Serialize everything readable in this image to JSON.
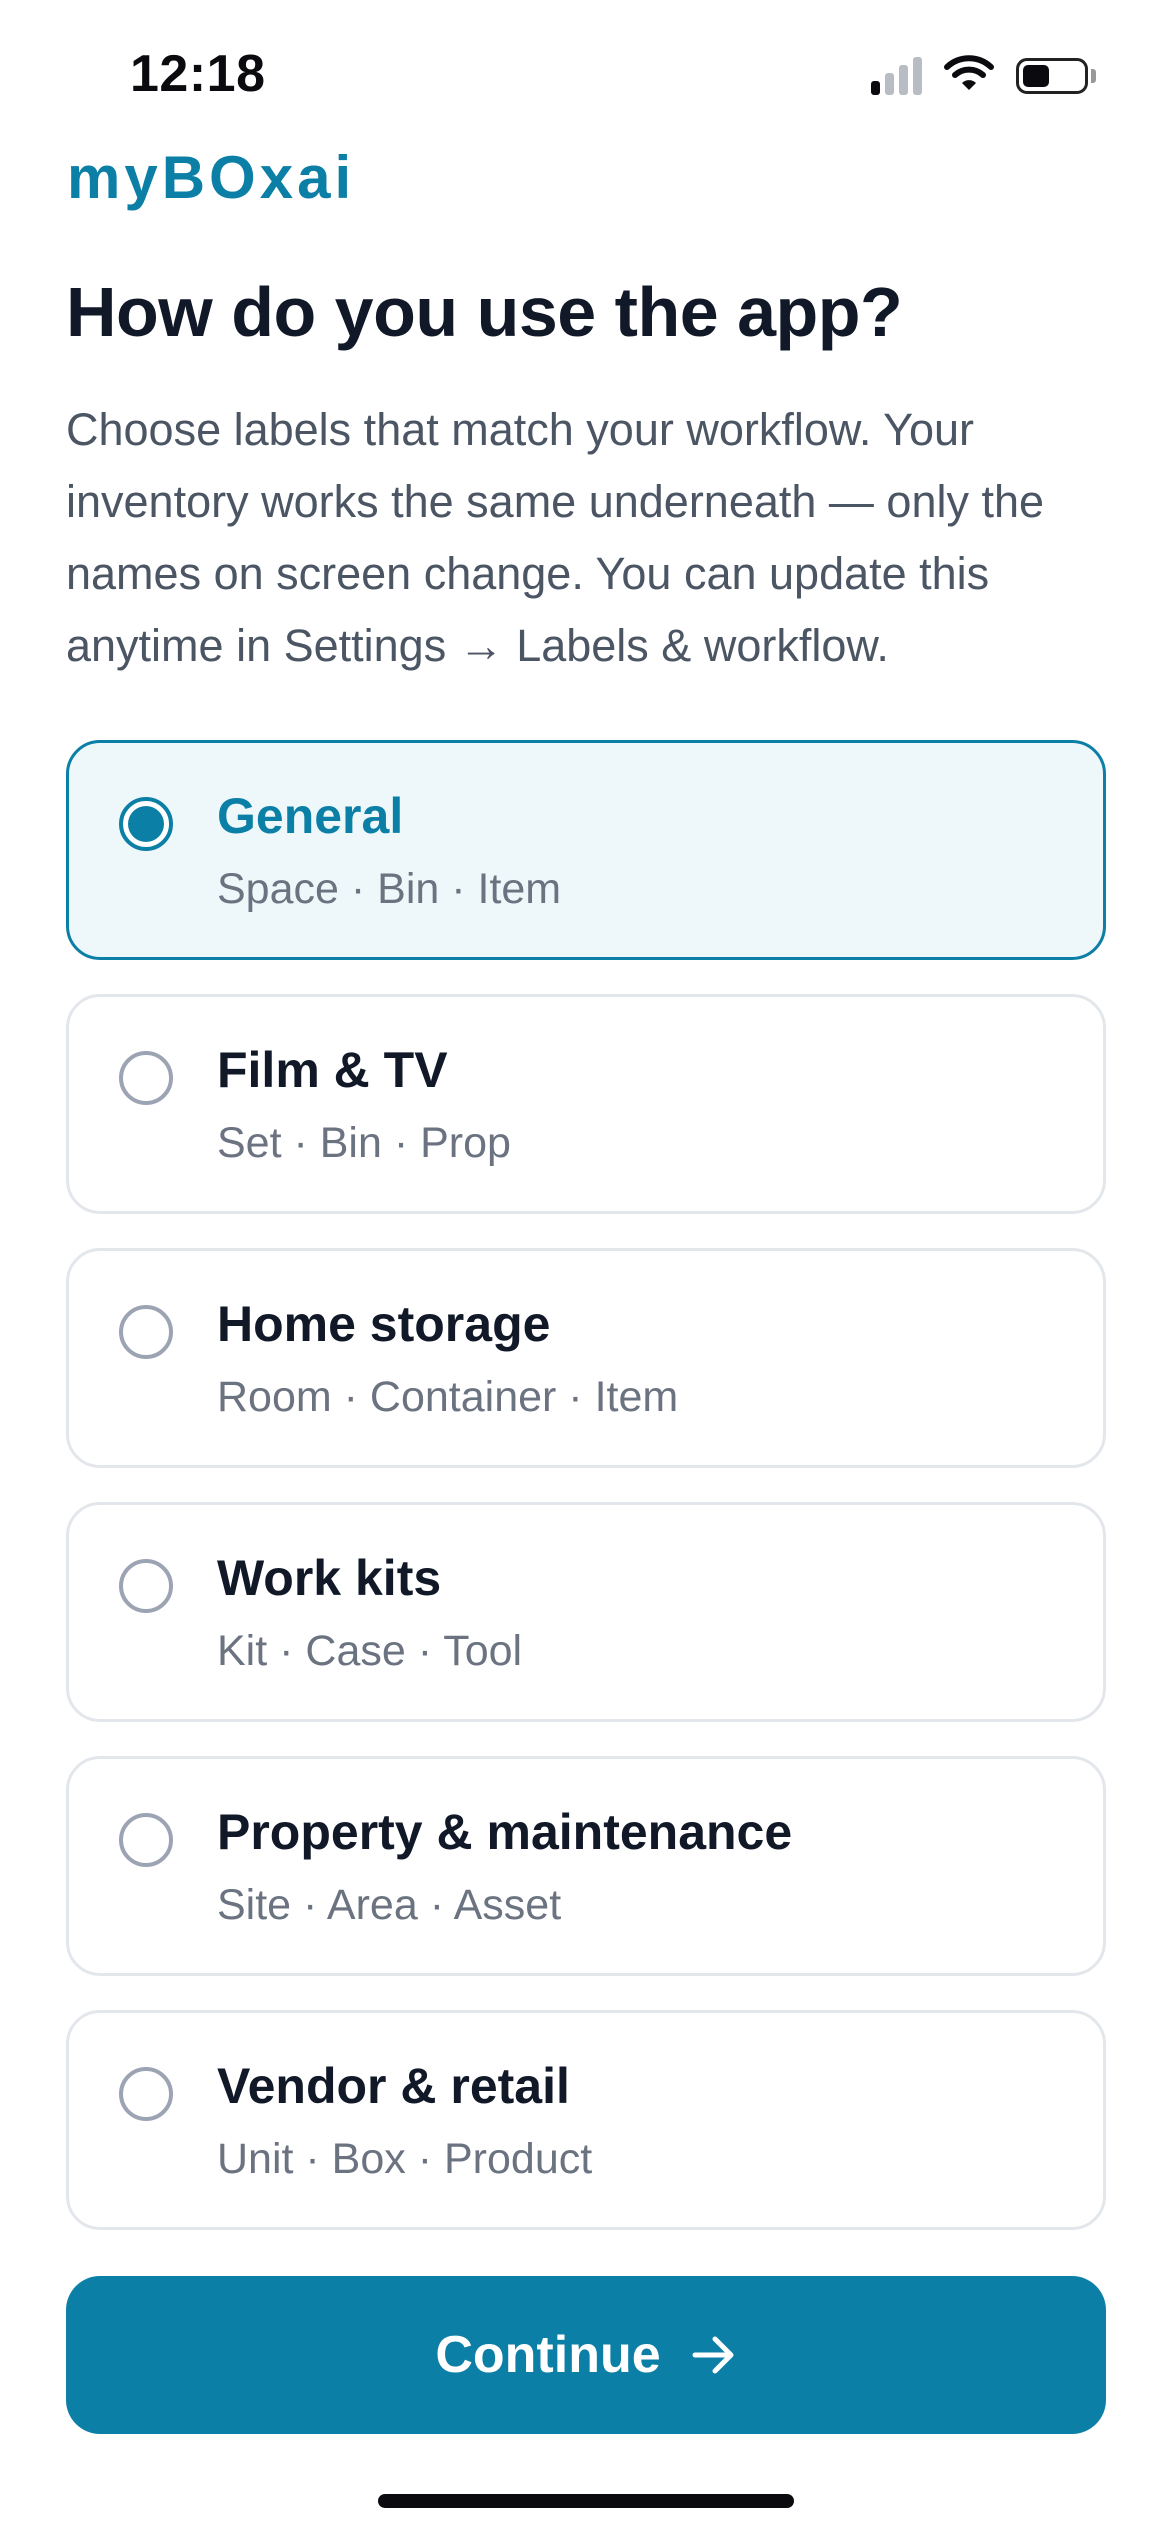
{
  "status_bar": {
    "time": "12:18",
    "icons": [
      "signal-icon",
      "wifi-icon",
      "battery-icon"
    ]
  },
  "brand": "myBOxai",
  "title": "How do you use the app?",
  "description": "Choose labels that match your workflow. Your inventory works the same underneath — only the names on screen change. You can update this anytime in Settings → Labels & workflow.",
  "options": [
    {
      "title": "General",
      "subtitle": "Space · Bin · Item",
      "selected": true
    },
    {
      "title": "Film & TV",
      "subtitle": "Set · Bin · Prop",
      "selected": false
    },
    {
      "title": "Home storage",
      "subtitle": "Room · Container · Item",
      "selected": false
    },
    {
      "title": "Work kits",
      "subtitle": "Kit · Case · Tool",
      "selected": false
    },
    {
      "title": "Property & maintenance",
      "subtitle": "Site · Area · Asset",
      "selected": false
    },
    {
      "title": "Vendor & retail",
      "subtitle": "Unit · Box · Product",
      "selected": false
    }
  ],
  "continue_button": {
    "label": "Continue",
    "icon": "arrow-right-icon"
  },
  "colors": {
    "accent": "#0b7fa5",
    "selected_background": "#eef8fb",
    "title_text": "#111827",
    "body_text": "#4b5563",
    "muted_text": "#6b7280",
    "card_border": "#e3e7ec"
  }
}
